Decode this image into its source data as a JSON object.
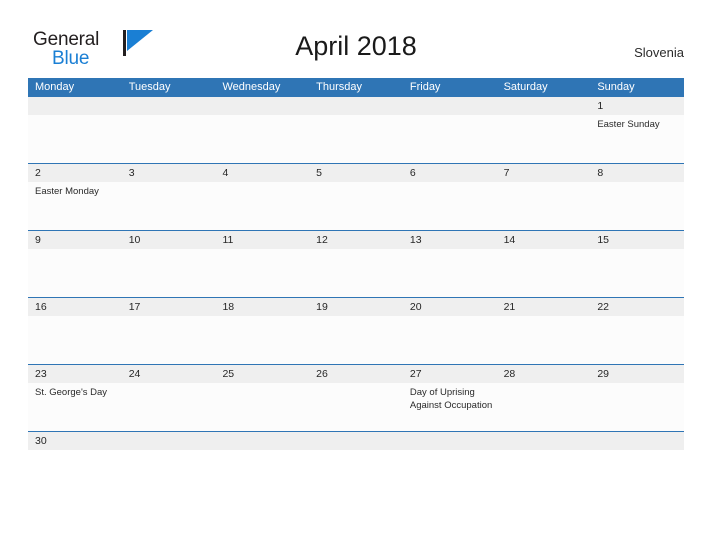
{
  "logo": {
    "word_one": "General",
    "word_two": "Blue",
    "flag_icon": "blue-flag-icon",
    "blue_hex": "#1a7fd4",
    "dark_hex": "#231f20"
  },
  "header": {
    "title": "April 2018",
    "region": "Slovenia",
    "accent_hex": "#2f75b5"
  },
  "calendar": {
    "weekdays": [
      "Monday",
      "Tuesday",
      "Wednesday",
      "Thursday",
      "Friday",
      "Saturday",
      "Sunday"
    ],
    "weeks": [
      {
        "days": [
          {
            "num": "",
            "events": []
          },
          {
            "num": "",
            "events": []
          },
          {
            "num": "",
            "events": []
          },
          {
            "num": "",
            "events": []
          },
          {
            "num": "",
            "events": []
          },
          {
            "num": "",
            "events": []
          },
          {
            "num": "1",
            "events": [
              "Easter Sunday"
            ]
          }
        ]
      },
      {
        "days": [
          {
            "num": "2",
            "events": [
              "Easter Monday"
            ]
          },
          {
            "num": "3",
            "events": []
          },
          {
            "num": "4",
            "events": []
          },
          {
            "num": "5",
            "events": []
          },
          {
            "num": "6",
            "events": []
          },
          {
            "num": "7",
            "events": []
          },
          {
            "num": "8",
            "events": []
          }
        ]
      },
      {
        "days": [
          {
            "num": "9",
            "events": []
          },
          {
            "num": "10",
            "events": []
          },
          {
            "num": "11",
            "events": []
          },
          {
            "num": "12",
            "events": []
          },
          {
            "num": "13",
            "events": []
          },
          {
            "num": "14",
            "events": []
          },
          {
            "num": "15",
            "events": []
          }
        ]
      },
      {
        "days": [
          {
            "num": "16",
            "events": []
          },
          {
            "num": "17",
            "events": []
          },
          {
            "num": "18",
            "events": []
          },
          {
            "num": "19",
            "events": []
          },
          {
            "num": "20",
            "events": []
          },
          {
            "num": "21",
            "events": []
          },
          {
            "num": "22",
            "events": []
          }
        ]
      },
      {
        "days": [
          {
            "num": "23",
            "events": [
              "St. George's Day"
            ]
          },
          {
            "num": "24",
            "events": []
          },
          {
            "num": "25",
            "events": []
          },
          {
            "num": "26",
            "events": []
          },
          {
            "num": "27",
            "events": [
              "Day of Uprising",
              "Against Occupation"
            ]
          },
          {
            "num": "28",
            "events": []
          },
          {
            "num": "29",
            "events": []
          }
        ]
      },
      {
        "last": true,
        "days": [
          {
            "num": "30",
            "events": []
          },
          {
            "num": "",
            "events": []
          },
          {
            "num": "",
            "events": []
          },
          {
            "num": "",
            "events": []
          },
          {
            "num": "",
            "events": []
          },
          {
            "num": "",
            "events": []
          },
          {
            "num": "",
            "events": []
          }
        ]
      }
    ]
  }
}
